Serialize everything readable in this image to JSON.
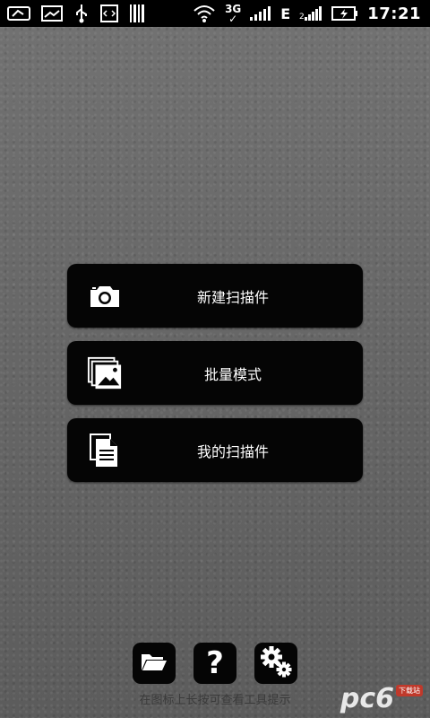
{
  "status_bar": {
    "time": "17:21",
    "network_type": "3G",
    "edge_label": "E",
    "icons": [
      "notification-icon",
      "image-icon",
      "usb-icon",
      "code-icon",
      "barcode-icon",
      "wifi-icon",
      "signal-icon",
      "battery-charging-icon"
    ]
  },
  "menu": {
    "items": [
      {
        "label": "新建扫描件",
        "icon": "camera-icon"
      },
      {
        "label": "批量模式",
        "icon": "images-stack-icon"
      },
      {
        "label": "我的扫描件",
        "icon": "documents-icon"
      }
    ]
  },
  "toolbar": {
    "buttons": [
      {
        "icon": "folder-icon"
      },
      {
        "icon": "help-icon",
        "glyph": "?"
      },
      {
        "icon": "settings-icon"
      }
    ],
    "hint": "在图标上长按可查看工具提示"
  },
  "watermark": {
    "text": "pc6",
    "badge": "下载站"
  }
}
